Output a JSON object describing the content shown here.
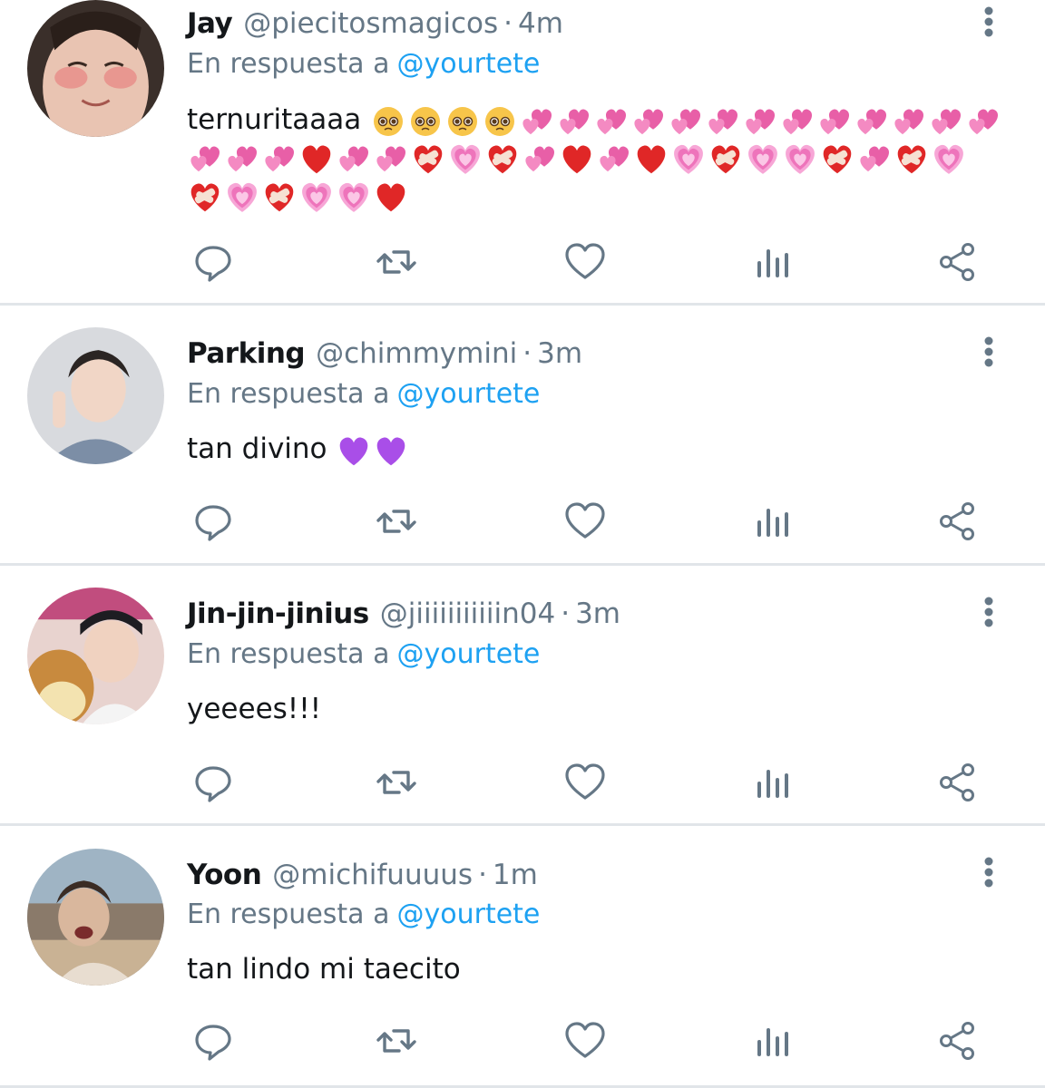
{
  "reply_prefix": "En respuesta a",
  "colors": {
    "name": "#14171a",
    "secondary": "#657786",
    "link": "#1da1f2",
    "divider": "#e1e5e9"
  },
  "tweets": [
    {
      "name": "Jay",
      "handle": "@piecitosmagicos",
      "separator": "·",
      "time": "4m",
      "reply_to": "@yourtete",
      "text": "ternuritaaaa",
      "emojis": [
        "pleading",
        "pleading",
        "pleading",
        "pleading",
        "two-hearts",
        "two-hearts",
        "two-hearts",
        "two-hearts",
        "two-hearts",
        "two-hearts",
        "two-hearts",
        "two-hearts",
        "two-hearts",
        "two-hearts",
        "two-hearts",
        "two-hearts",
        "two-hearts",
        "two-hearts",
        "two-hearts",
        "two-hearts",
        "red-heart",
        "two-hearts",
        "two-hearts",
        "mending-heart",
        "growing-heart",
        "mending-heart",
        "two-hearts",
        "red-heart",
        "two-hearts",
        "red-heart",
        "growing-heart",
        "mending-heart",
        "growing-heart",
        "growing-heart",
        "mending-heart",
        "two-hearts",
        "mending-heart",
        "growing-heart",
        "mending-heart",
        "growing-heart",
        "mending-heart",
        "growing-heart",
        "growing-heart",
        "red-heart"
      ]
    },
    {
      "name": "Parking",
      "handle": "@chimmymini",
      "separator": "·",
      "time": "3m",
      "reply_to": "@yourtete",
      "text": "tan divino",
      "emojis": [
        "purple-heart",
        "purple-heart"
      ]
    },
    {
      "name": "Jin-jin-jinius",
      "handle": "@jiiiiiiiiiiin04",
      "separator": "·",
      "time": "3m",
      "reply_to": "@yourtete",
      "text": "yeeees!!!",
      "emojis": []
    },
    {
      "name": "Yoon",
      "handle": "@michifuuuus",
      "separator": "·",
      "time": "1m",
      "reply_to": "@yourtete",
      "text": "tan lindo mi taecito",
      "emojis": []
    }
  ],
  "actions": [
    "reply-icon",
    "retweet-icon",
    "like-icon",
    "analytics-icon",
    "share-icon"
  ]
}
